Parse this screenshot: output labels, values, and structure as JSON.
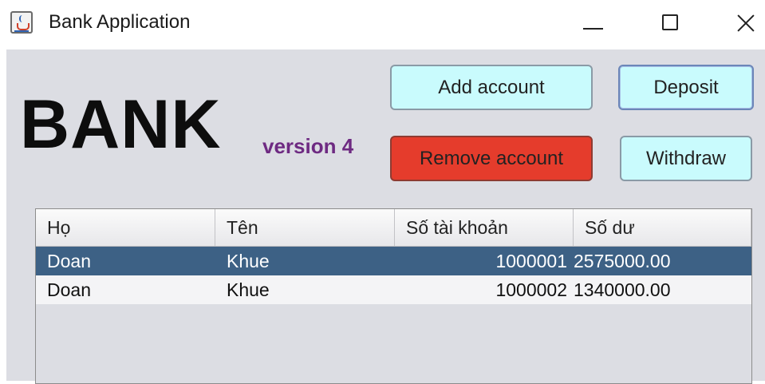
{
  "window": {
    "title": "Bank Application",
    "icon": "java-cup-icon",
    "controls": [
      "minimize",
      "maximize",
      "close"
    ]
  },
  "logo": {
    "text": "BANK",
    "version": "version 4",
    "version_color": "#6e2a82"
  },
  "buttons": {
    "add_account": "Add account",
    "deposit": "Deposit",
    "remove_account": "Remove account",
    "withdraw": "Withdraw"
  },
  "colors": {
    "button_light": "#c9fbfd",
    "button_danger": "#e53c2c",
    "selected_row": "#3d6185",
    "panel_background": "#dcdde3"
  },
  "table": {
    "columns": [
      "Họ",
      "Tên",
      "Số tài khoản",
      "Số dư"
    ],
    "rows": [
      {
        "ho": "Doan",
        "ten": "Khue",
        "so_tai_khoan": "1000001",
        "so_du": "2575000.00",
        "selected": true
      },
      {
        "ho": "Doan",
        "ten": "Khue",
        "so_tai_khoan": "1000002",
        "so_du": "1340000.00",
        "selected": false
      }
    ]
  }
}
